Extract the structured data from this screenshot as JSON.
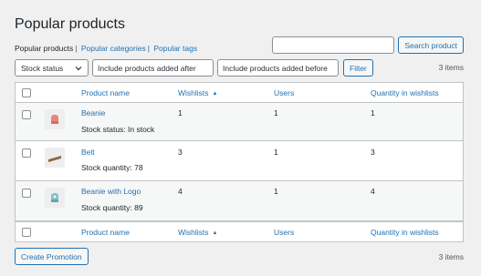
{
  "page": {
    "title": "Popular products"
  },
  "subnav": {
    "current": "Popular products",
    "links": [
      "Popular categories",
      "Popular tags"
    ],
    "separator": "|"
  },
  "search": {
    "value": "",
    "button": "Search product"
  },
  "filters": {
    "stock_select": "Stock status",
    "date_from_placeholder": "Include products added after",
    "date_to_placeholder": "Include products added before",
    "filter_button": "Filter"
  },
  "items_count": "3 items",
  "table": {
    "headers": {
      "product": "Product name",
      "wishlists": "Wishlists",
      "users": "Users",
      "quantity": "Quantity in wishlists"
    },
    "rows": [
      {
        "name": "Beanie",
        "stock": "Stock status: In stock",
        "wishlists": "1",
        "users": "1",
        "quantity": "1",
        "thumb_color": "#e8867a",
        "thumb_icon": "beanie-icon"
      },
      {
        "name": "Belt",
        "stock": "Stock quantity: 78",
        "wishlists": "3",
        "users": "1",
        "quantity": "3",
        "thumb_color": "#8a6a4a",
        "thumb_icon": "belt-icon"
      },
      {
        "name": "Beanie with Logo",
        "stock": "Stock quantity: 89",
        "wishlists": "4",
        "users": "1",
        "quantity": "4",
        "thumb_color": "#7ec4c6",
        "thumb_icon": "beanie-logo-icon"
      }
    ]
  },
  "bottom": {
    "button": "Create Promotion",
    "items_count": "3 items"
  },
  "colors": {
    "link": "#2271b1",
    "border": "#c3c4c7",
    "background": "#f0f0f1"
  }
}
